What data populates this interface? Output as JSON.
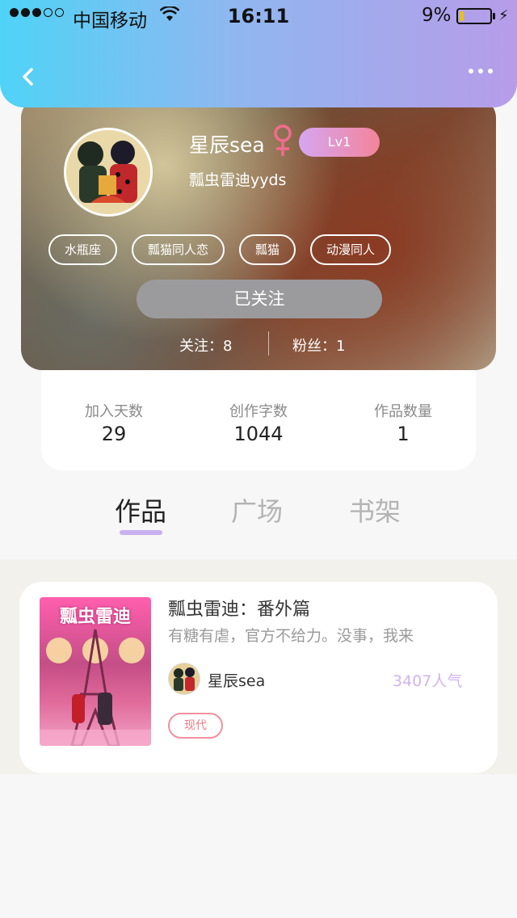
{
  "status_bar": {
    "carrier": "中国移动",
    "time": "16:11",
    "battery_percent": "9%",
    "battery_level": 0.09
  },
  "nav": {
    "back_icon": "chevron-left-icon",
    "more_icon": "more-horizontal-icon"
  },
  "profile": {
    "username": "星辰sea",
    "gender_icon": "female-symbol-icon",
    "level": "Lv1",
    "bio": "瓢虫雷迪yyds",
    "tags": [
      "水瓶座",
      "瓢猫同人恋",
      "瓢猫",
      "动漫同人"
    ],
    "follow_button": "已关注",
    "following": "关注：8",
    "followers": "粉丝：1"
  },
  "stats": [
    {
      "label": "加入天数",
      "value": "29"
    },
    {
      "label": "创作字数",
      "value": "1044"
    },
    {
      "label": "作品数量",
      "value": "1"
    }
  ],
  "tabs": [
    {
      "label": "作品",
      "active": true
    },
    {
      "label": "广场",
      "active": false
    },
    {
      "label": "书架",
      "active": false
    }
  ],
  "works": [
    {
      "cover_title": "瓢虫雷迪",
      "title": "瓢虫雷迪：番外篇",
      "description": "有糖有虐，官方不给力。没事，我来",
      "author": "星辰sea",
      "popularity": "3407人气",
      "genre": "现代"
    }
  ],
  "colors": {
    "header_gradient_start": "#4fd3f6",
    "header_gradient_end": "#b79ce9",
    "accent_purple": "#c9b0ee",
    "genre_pink": "#f07984",
    "gender_pink": "#f36b8d"
  }
}
